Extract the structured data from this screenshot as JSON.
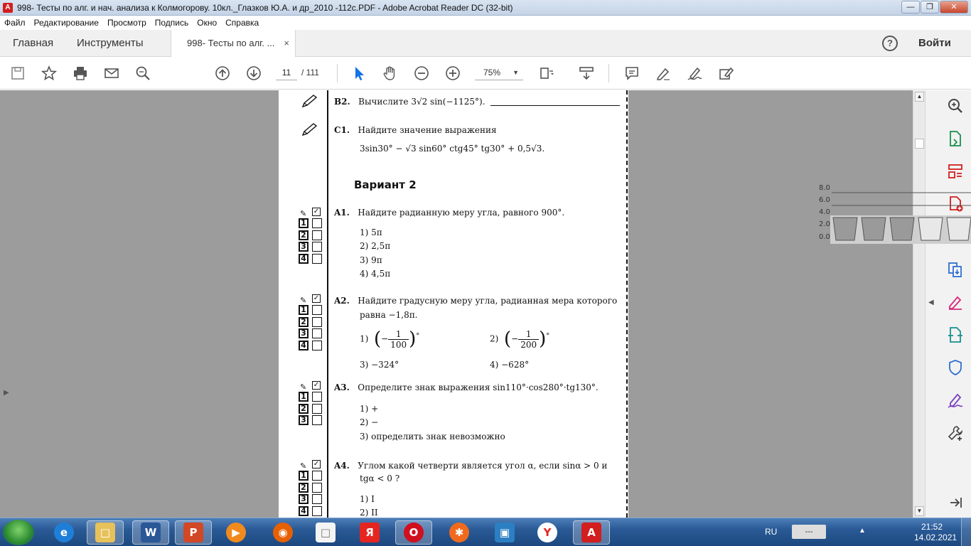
{
  "window": {
    "title": "998- Тесты по алг. и нач. анализа к Колмогорову. 10кл._Глазков Ю.А. и др_2010 -112с.PDF - Adobe Acrobat Reader DC (32-bit)",
    "app_icon_letter": "A"
  },
  "menu": [
    "Файл",
    "Редактирование",
    "Просмотр",
    "Подпись",
    "Окно",
    "Справка"
  ],
  "tabs": {
    "home": "Главная",
    "tools": "Инструменты",
    "doc": "998- Тесты по алг. ...",
    "close": "×",
    "signin": "Войти",
    "help": "?"
  },
  "toolbar": {
    "page_current": "11",
    "page_total": "/ 111",
    "zoom": "75%"
  },
  "document": {
    "b2": {
      "label": "B2.",
      "text": "Вычислите 3√2 sin(−1125°)."
    },
    "c1": {
      "label": "C1.",
      "text": "Найдите значение выражения",
      "expr": "3sin30° − √3 sin60° ctg45° tg30° + 0,5√3."
    },
    "variant": "Вариант 2",
    "a1": {
      "label": "A1.",
      "text": "Найдите радианную меру угла, равного 900°.",
      "options": [
        "1)  5π",
        "2)  2,5π",
        "3)  9π",
        "4)  4,5π"
      ]
    },
    "a2": {
      "label": "A2.",
      "text1": "Найдите градусную меру угла, радианная мера которого",
      "text2": "равна −1,8π.",
      "opt1_prefix": "1)",
      "opt1_num": "1",
      "opt1_den": "100",
      "opt2_prefix": "2)",
      "opt2_num": "1",
      "opt2_den": "200",
      "opt3": "3)  −324°",
      "opt4": "4)  −628°"
    },
    "a3": {
      "label": "A3.",
      "text": "Определите знак выражения sin110°·cos280°·tg130°.",
      "options": [
        "1)  +",
        "2)  −",
        "3)  определить знак невозможно"
      ]
    },
    "a4": {
      "label": "A4.",
      "text1": "Углом какой четверти является угол α, если sinα > 0 и",
      "text2": "tgα < 0 ?",
      "options": [
        "1)  I",
        "2)  II"
      ]
    },
    "ans_numbers": [
      "1",
      "2",
      "3",
      "4"
    ]
  },
  "overlay_chart_ticks": [
    "8.0",
    "6.0",
    "4.0",
    "2.0",
    "0.0"
  ],
  "taskbar": {
    "lang": "RU",
    "tray_box": "---",
    "time": "21:52",
    "date": "14.02.2021"
  },
  "colors": {
    "acrobat_red": "#d21e1e",
    "accent_blue": "#1473e6",
    "workspace_gray": "#9c9c9c"
  }
}
